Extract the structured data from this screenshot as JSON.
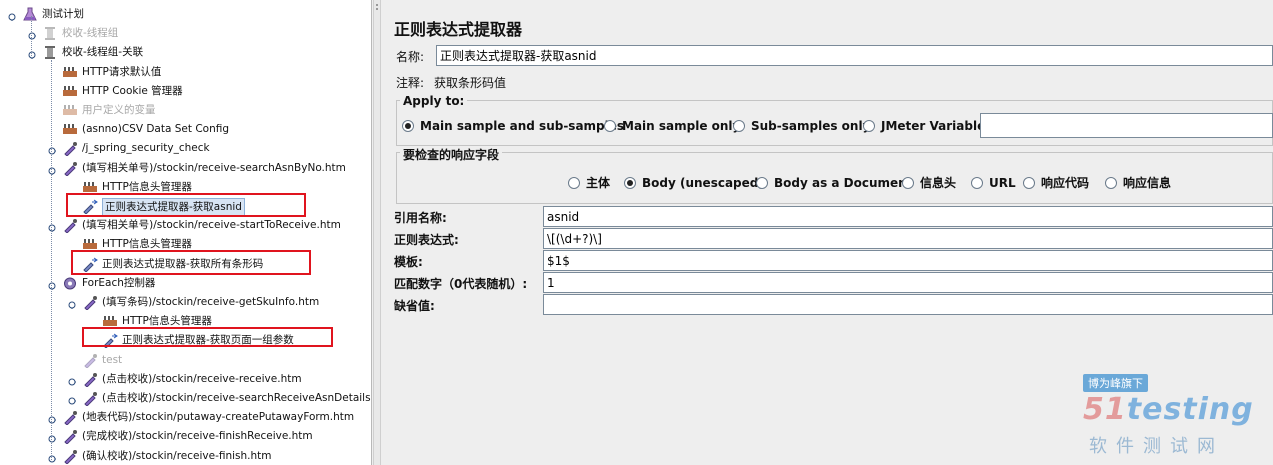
{
  "tree": {
    "nodes": [
      {
        "label": "测试计划",
        "icon": "flask-icon",
        "disabled": false
      },
      {
        "label": "校收-线程组",
        "icon": "spool-icon",
        "disabled": true
      },
      {
        "label": "校收-线程组-关联",
        "icon": "spool-icon",
        "disabled": false
      },
      {
        "label": "HTTP请求默认值",
        "icon": "wrench-icon",
        "disabled": false
      },
      {
        "label": "HTTP Cookie 管理器",
        "icon": "wrench-icon",
        "disabled": false
      },
      {
        "label": "用户定义的变量",
        "icon": "wrench-icon",
        "disabled": true
      },
      {
        "label": "(asnno)CSV Data Set Config",
        "icon": "wrench-icon",
        "disabled": false
      },
      {
        "label": "/j_spring_security_check",
        "icon": "pipette-icon",
        "disabled": false
      },
      {
        "label": "(填写相关单号)/stockin/receive-searchAsnByNo.htm",
        "icon": "pipette-icon",
        "disabled": false
      },
      {
        "label": "HTTP信息头管理器",
        "icon": "wrench-icon",
        "disabled": false
      },
      {
        "label": "正则表达式提取器-获取asnid",
        "icon": "extractor-icon",
        "disabled": false,
        "selected": true
      },
      {
        "label": "(填写相关单号)/stockin/receive-startToReceive.htm",
        "icon": "pipette-icon",
        "disabled": false
      },
      {
        "label": "HTTP信息头管理器",
        "icon": "wrench-icon",
        "disabled": false
      },
      {
        "label": "正则表达式提取器-获取所有条形码",
        "icon": "extractor-icon",
        "disabled": false
      },
      {
        "label": "ForEach控制器",
        "icon": "gear-icon",
        "disabled": false
      },
      {
        "label": "(填写条码)/stockin/receive-getSkuInfo.htm",
        "icon": "pipette-icon",
        "disabled": false
      },
      {
        "label": "HTTP信息头管理器",
        "icon": "wrench-icon",
        "disabled": false
      },
      {
        "label": "正则表达式提取器-获取页面一组参数",
        "icon": "extractor-icon",
        "disabled": false
      },
      {
        "label": "test",
        "icon": "pipette-icon",
        "disabled": true
      },
      {
        "label": "(点击校收)/stockin/receive-receive.htm",
        "icon": "pipette-icon",
        "disabled": false
      },
      {
        "label": "(点击校收)/stockin/receive-searchReceiveAsnDetails.h",
        "icon": "pipette-icon",
        "disabled": false
      },
      {
        "label": "(地表代码)/stockin/putaway-createPutawayForm.htm",
        "icon": "pipette-icon",
        "disabled": false
      },
      {
        "label": "(完成校收)/stockin/receive-finishReceive.htm",
        "icon": "pipette-icon",
        "disabled": false
      },
      {
        "label": "(确认校收)/stockin/receive-finish.htm",
        "icon": "pipette-icon",
        "disabled": false
      }
    ]
  },
  "panel": {
    "title": "正则表达式提取器",
    "name_label": "名称:",
    "name_value": "正则表达式提取器-获取asnid",
    "comment_label": "注释:",
    "comment_value": "获取条形码值",
    "apply_to": {
      "title": "Apply to:",
      "options": [
        "Main sample and sub-samples",
        "Main sample only",
        "Sub-samples only",
        "JMeter Variable"
      ],
      "selected": "Main sample and sub-samples",
      "variable_value": ""
    },
    "field_check": {
      "title": "要检查的响应字段",
      "options": [
        "主体",
        "Body (unescaped)",
        "Body as a Document",
        "信息头",
        "URL",
        "响应代码",
        "响应信息"
      ],
      "selected": "Body (unescaped)"
    },
    "ref_name_label": "引用名称:",
    "ref_name_value": "asnid",
    "regex_label": "正则表达式:",
    "regex_value": "\\[(\\d+?)\\]",
    "template_label": "模板:",
    "template_value": "$1$",
    "match_label": "匹配数字（0代表随机）:",
    "match_value": "1",
    "default_label": "缺省值:",
    "default_value": ""
  },
  "watermark": {
    "tag": "博为峰旗下",
    "logo_prefix": "51",
    "logo_text": "testing",
    "subtitle": "软件测试网"
  }
}
